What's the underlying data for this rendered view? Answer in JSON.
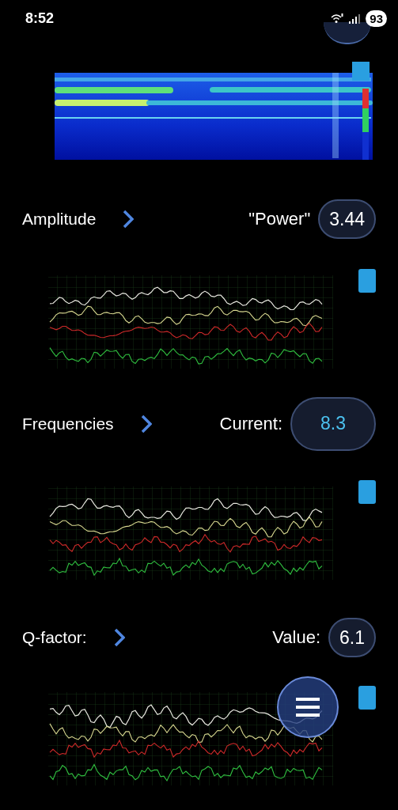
{
  "status_bar": {
    "time": "8:52",
    "battery": "93"
  },
  "sections": [
    {
      "kind": "spectrogram"
    },
    {
      "kind": "reading",
      "label": "Amplitude",
      "value_label": "\"Power\"",
      "value": "3.44",
      "highlighted": false
    },
    {
      "kind": "line_chart"
    },
    {
      "kind": "reading",
      "label": "Frequencies",
      "value_label": "Current:",
      "value": "8.3",
      "highlighted": true
    },
    {
      "kind": "line_chart"
    },
    {
      "kind": "reading",
      "label": "Q-factor:",
      "value_label": "Value:",
      "value": "6.1",
      "highlighted": false
    },
    {
      "kind": "line_chart"
    }
  ]
}
